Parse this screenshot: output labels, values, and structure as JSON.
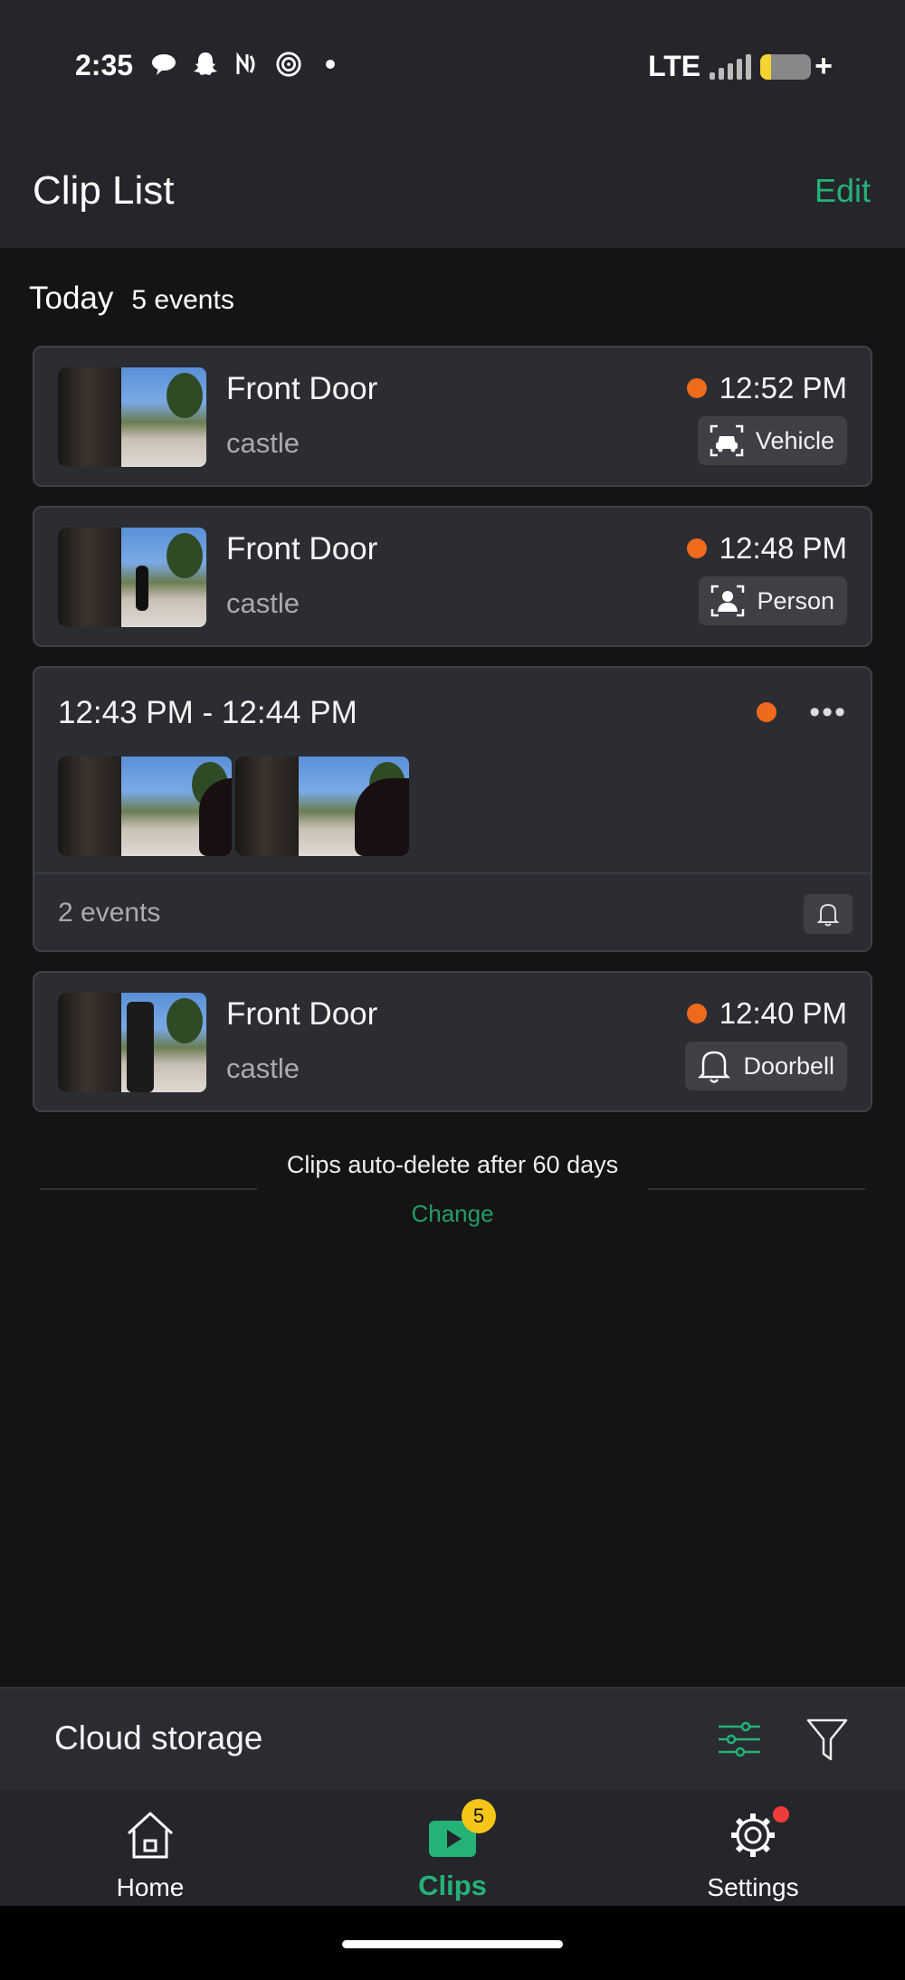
{
  "status_bar": {
    "time": "2:35",
    "network": "LTE",
    "icons": [
      "chat-bubble-icon",
      "snapchat-icon",
      "nfc-icon",
      "camera-ring-icon",
      "dot-icon"
    ]
  },
  "header": {
    "title": "Clip List",
    "edit_label": "Edit"
  },
  "section": {
    "day": "Today",
    "count": "5 events"
  },
  "clips": [
    {
      "title": "Front Door",
      "subtitle": "castle",
      "time": "12:52 PM",
      "tag": "Vehicle",
      "tag_icon": "vehicle-detect-icon"
    },
    {
      "title": "Front Door",
      "subtitle": "castle",
      "time": "12:48 PM",
      "tag": "Person",
      "tag_icon": "person-detect-icon"
    },
    {
      "title": "Front Door",
      "subtitle": "castle",
      "time": "12:40 PM",
      "tag": "Doorbell",
      "tag_icon": "bell-icon"
    }
  ],
  "group": {
    "time_range": "12:43 PM - 12:44 PM",
    "more": "•••",
    "count": "2 events"
  },
  "footer": {
    "note": "Clips auto-delete after 60 days",
    "change_label": "Change"
  },
  "cloud": {
    "title": "Cloud storage"
  },
  "nav": {
    "home": "Home",
    "clips": "Clips",
    "clips_badge": "5",
    "settings": "Settings"
  },
  "colors": {
    "accent": "#25b276",
    "event_dot": "#ee6a1c",
    "badge": "#f5c518",
    "notification_dot": "#ef3b3b"
  }
}
